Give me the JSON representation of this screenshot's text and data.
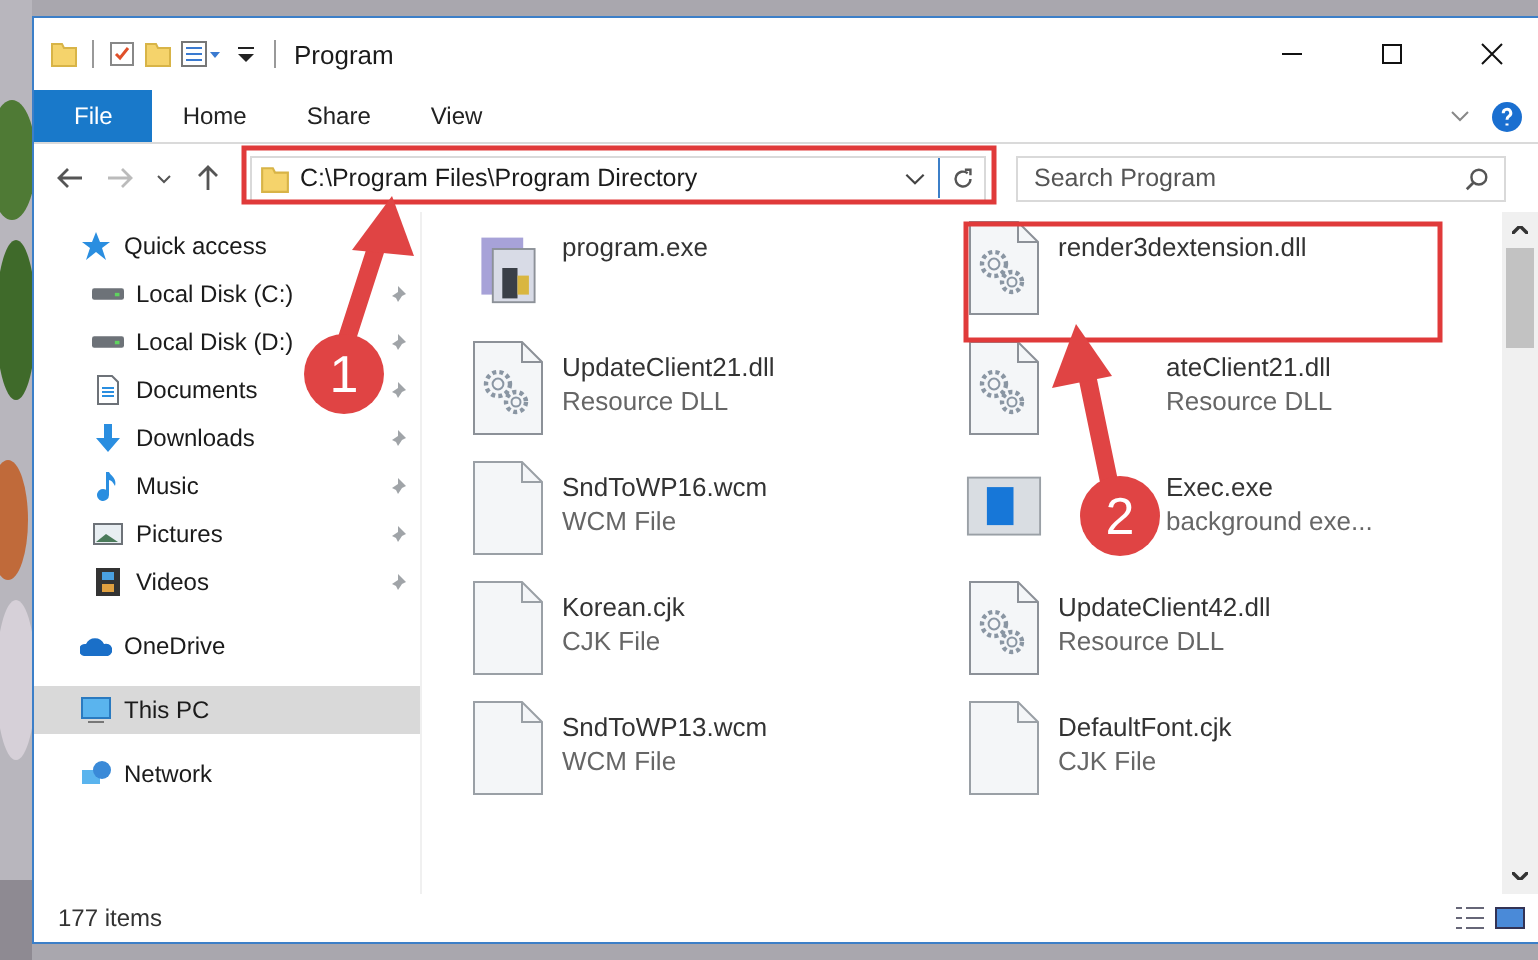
{
  "window": {
    "title": "Program"
  },
  "ribbon_tabs": [
    {
      "label": "File",
      "selected": true
    },
    {
      "label": "Home",
      "selected": false
    },
    {
      "label": "Share",
      "selected": false
    },
    {
      "label": "View",
      "selected": false
    }
  ],
  "address_bar": {
    "path": "C:\\Program Files\\Program Directory"
  },
  "search": {
    "placeholder": "Search Program"
  },
  "sidebar": {
    "items": [
      {
        "label": "Quick access",
        "kind": "star",
        "selected": false,
        "children": [
          {
            "label": "Local Disk (C:)",
            "kind": "drive",
            "pinned": true,
            "selected": false
          },
          {
            "label": "Local Disk (D:)",
            "kind": "drive",
            "pinned": true,
            "selected": false
          },
          {
            "label": "Documents",
            "kind": "document",
            "pinned": true,
            "selected": false
          },
          {
            "label": "Downloads",
            "kind": "download",
            "pinned": true,
            "selected": false
          },
          {
            "label": "Music",
            "kind": "music",
            "pinned": true,
            "selected": false
          },
          {
            "label": "Pictures",
            "kind": "pictures",
            "pinned": true,
            "selected": false
          },
          {
            "label": "Videos",
            "kind": "videos",
            "pinned": true,
            "selected": false
          }
        ]
      },
      {
        "label": "OneDrive",
        "kind": "cloud",
        "selected": false
      },
      {
        "label": "This PC",
        "kind": "pc",
        "selected": true
      },
      {
        "label": "Network",
        "kind": "network",
        "selected": false
      }
    ]
  },
  "files": [
    {
      "name": "program.exe",
      "kind": "exe"
    },
    {
      "name": "render3dextension.dll",
      "kind": "dll"
    },
    {
      "name": "UpdateClient21.dll",
      "type": "Resource DLL",
      "kind": "dll"
    },
    {
      "name": "ateClient21.dll",
      "type": "Resource DLL",
      "kind": "dll",
      "covered": true
    },
    {
      "name": "SndToWP16.wcm",
      "type": "WCM File",
      "kind": "blank"
    },
    {
      "name": "Exec.exe",
      "type": "background exe...",
      "kind": "app",
      "covered": true
    },
    {
      "name": "Korean.cjk",
      "type": "CJK File",
      "kind": "blank"
    },
    {
      "name": "UpdateClient42.dll",
      "type": "Resource DLL",
      "kind": "dll"
    },
    {
      "name": "SndToWP13.wcm",
      "type": "WCM File",
      "kind": "blank"
    },
    {
      "name": "DefaultFont.cjk",
      "type": "CJK File",
      "kind": "blank"
    }
  ],
  "status_bar": {
    "count": "177 items"
  },
  "annotations": [
    {
      "number": "1"
    },
    {
      "number": "2"
    }
  ]
}
